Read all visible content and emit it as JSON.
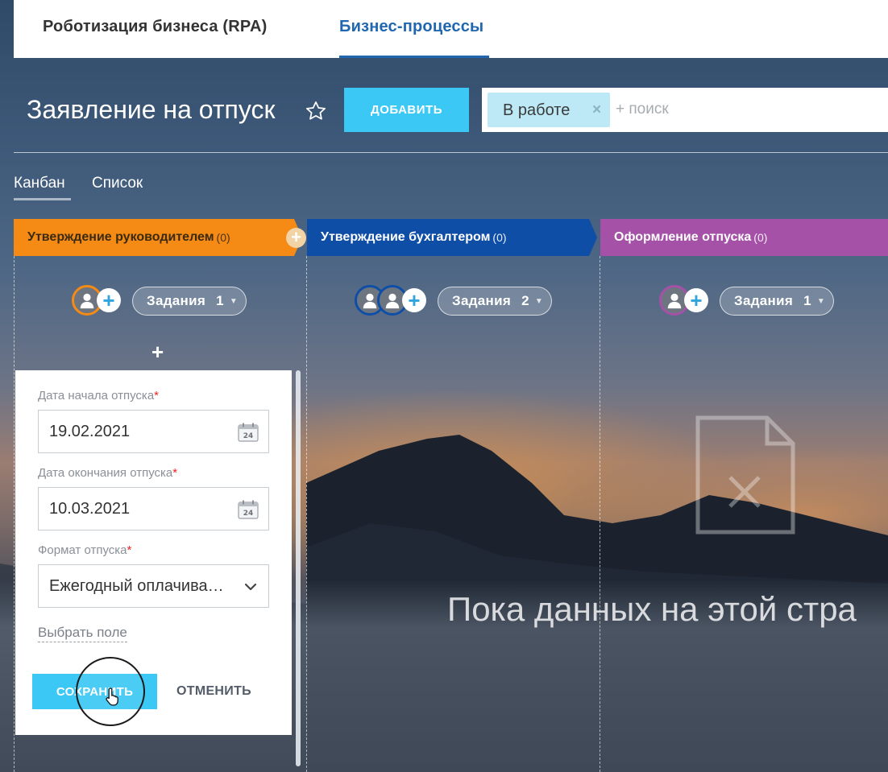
{
  "topnav": {
    "tab_rpa": "Роботизация бизнеса (RPA)",
    "tab_bp": "Бизнес-процессы"
  },
  "header": {
    "title": "Заявление на отпуск",
    "add_label": "ДОБАВИТЬ",
    "filter_chip": "В работе",
    "search_placeholder": "+ поиск"
  },
  "view_tabs": {
    "kanban": "Канбан",
    "list": "Список"
  },
  "stages": [
    {
      "label": "Утверждение руководителем",
      "count": "(0)",
      "color": "#f58a14",
      "tasks_label": "Задания",
      "tasks_count": "1"
    },
    {
      "label": "Утверждение бухгалтером",
      "count": "(0)",
      "color": "#0e4ea6",
      "tasks_label": "Задания",
      "tasks_count": "2"
    },
    {
      "label": "Оформление отпуска",
      "count": "(0)",
      "color": "#a551a8",
      "tasks_label": "Задания",
      "tasks_count": "1"
    }
  ],
  "form": {
    "start_label": "Дата начала отпуска",
    "start_value": "19.02.2021",
    "end_label": "Дата окончания отпуска",
    "end_value": "10.03.2021",
    "format_label": "Формат отпуска",
    "format_value": "Ежегодный оплачива…",
    "choose_field": "Выбрать поле",
    "save_label": "СОХРАНИТЬ",
    "cancel_label": "ОТМЕНИТЬ",
    "required_mark": "*",
    "calendar_day": "24"
  },
  "empty_state": {
    "text": "Пока данных на этой стра"
  },
  "icons": {
    "star": "star-icon",
    "calendar": "calendar-icon",
    "chevron": "chevron-down-icon",
    "user": "user-icon",
    "plus": "plus-icon",
    "cursor": "hand-cursor-icon",
    "document": "document-icon"
  },
  "colors": {
    "accent": "#3bc8f5",
    "nav_active": "#2067b0"
  }
}
